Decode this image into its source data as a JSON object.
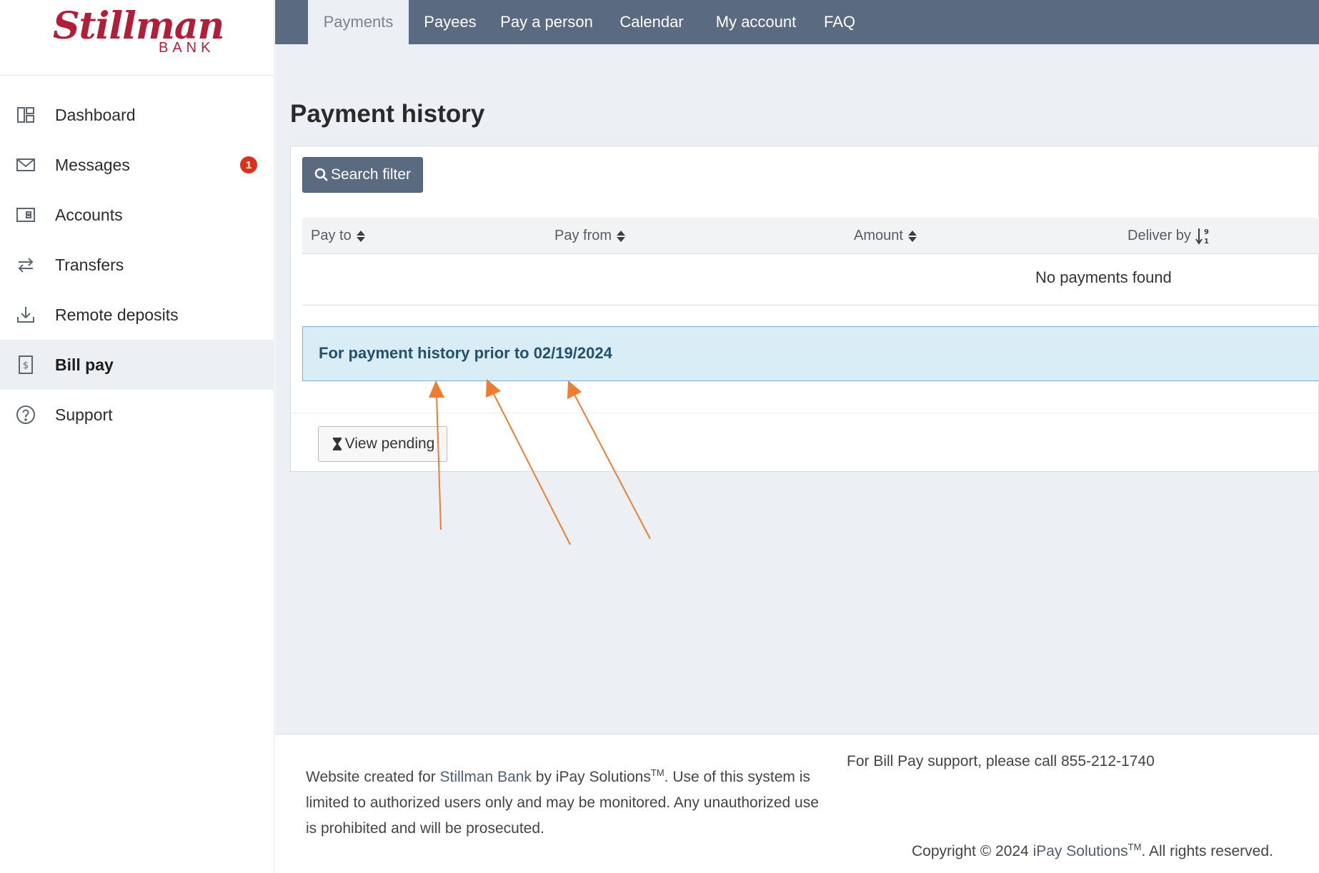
{
  "logo": {
    "name": "Stillman",
    "sub": "BANK"
  },
  "sidebar": {
    "items": [
      {
        "label": "Dashboard",
        "icon": "dashboard-icon"
      },
      {
        "label": "Messages",
        "icon": "envelope-icon",
        "badge": "1"
      },
      {
        "label": "Accounts",
        "icon": "wallet-icon"
      },
      {
        "label": "Transfers",
        "icon": "transfer-arrows-icon"
      },
      {
        "label": "Remote deposits",
        "icon": "download-icon"
      },
      {
        "label": "Bill pay",
        "icon": "bill-icon",
        "active": true
      },
      {
        "label": "Support",
        "icon": "question-circle-icon"
      }
    ]
  },
  "tabs": [
    {
      "label": "Payments",
      "active": true
    },
    {
      "label": "Payees"
    },
    {
      "label": "Pay a person"
    },
    {
      "label": "Calendar"
    },
    {
      "label": "My account"
    },
    {
      "label": "FAQ"
    }
  ],
  "page": {
    "title": "Payment history",
    "search_filter_label": "Search filter",
    "table": {
      "columns": [
        "Pay to",
        "Pay from",
        "Amount",
        "Deliver by"
      ],
      "empty_message": "No payments found"
    },
    "info_link": "For payment history prior to 02/19/2024",
    "view_pending_label": "View pending"
  },
  "footer": {
    "created_prefix": "Website created for ",
    "bank_link": "Stillman Bank",
    "created_mid": " by iPay Solutions",
    "tm": "TM",
    "created_suffix": ". Use of this system is limited to authorized users only and may be monitored. Any unauthorized use is prohibited and will be prosecuted.",
    "support_text": "For Bill Pay support, please call 855-212-1740",
    "copyright_prefix": "Copyright © 2024 ",
    "copyright_link": "iPay Solutions",
    "copyright_suffix": ". All rights reserved."
  },
  "colors": {
    "brand": "#b01e3a",
    "nav_bar": "#5a6a80",
    "content_bg": "#ecf0f5",
    "info_bg": "#d9edf7",
    "badge": "#d9331f",
    "annotation_arrow": "#ee7d31"
  }
}
